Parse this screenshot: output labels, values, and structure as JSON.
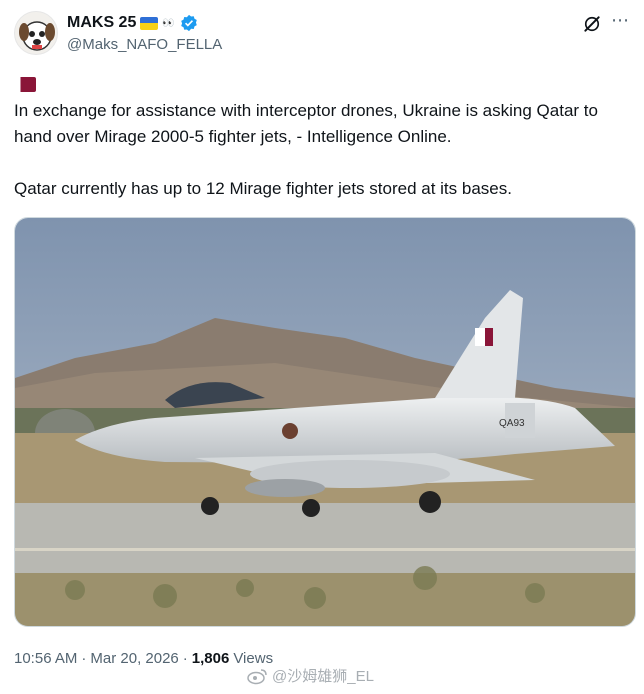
{
  "author": {
    "display_name": "MAKS 25",
    "emoji_suffix": "👀",
    "handle": "@Maks_NAFO_FELLA",
    "verified": true
  },
  "tweet": {
    "paragraph1": "In exchange for assistance with interceptor drones, Ukraine is asking Qatar to hand over Mirage 2000-5 fighter jets, - Intelligence Online.",
    "paragraph2": "Qatar currently has up to 12 Mirage fighter jets stored at its bases.",
    "flags": [
      "qatar-flag-icon",
      "ukraine-flag-icon"
    ]
  },
  "media": {
    "tail_code": "QA93"
  },
  "meta": {
    "time": "10:56 AM",
    "date": "Mar 20, 2026",
    "views_count": "1,806",
    "views_label": "Views",
    "separator": "·"
  },
  "watermark": {
    "text": "@沙姆雄狮_EL"
  },
  "colors": {
    "text": "#0f1419",
    "secondary": "#536471",
    "verified": "#1d9bf0",
    "qatar_maroon": "#8a1538"
  },
  "icons": {
    "grok": "grok-icon",
    "more": "more-options-icon",
    "verified": "verified-badge-icon"
  }
}
